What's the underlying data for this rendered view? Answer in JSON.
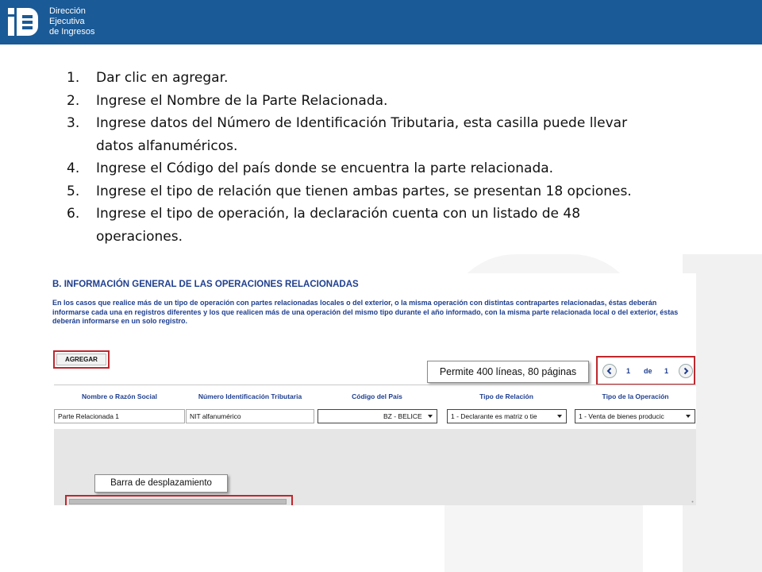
{
  "header": {
    "brand_color": "#1a5a96",
    "logo_icon": "die-logo-icon",
    "logo_line1": "Dirección",
    "logo_line2": "Ejecutiva",
    "logo_line3": "de Ingresos"
  },
  "steps": [
    {
      "num": "1.",
      "text": "Dar clic en agregar."
    },
    {
      "num": "2.",
      "text": "Ingrese el Nombre de la Parte Relacionada."
    },
    {
      "num": "3.",
      "text": "Ingrese datos del Número de Identificación Tributaria, esta casilla puede llevar datos alfanuméricos."
    },
    {
      "num": "4.",
      "text": "Ingrese el Código del país donde se encuentra la parte relacionada."
    },
    {
      "num": "5.",
      "text": "Ingrese el tipo de relación que tienen ambas partes, se presentan 18 opciones."
    },
    {
      "num": "6.",
      "text": "Ingrese el tipo de operación, la declaración cuenta con un listado de 48 operaciones."
    }
  ],
  "form": {
    "section_title": "B. INFORMACIÓN GENERAL DE LAS OPERACIONES RELACIONADAS",
    "section_desc": "En los casos que realice más de un tipo de operación con partes relacionadas locales o del exterior, o la misma operación con distintas contrapartes relacionadas, éstas deberán informarse cada una en registros diferentes y los que realicen más de una operación del mismo tipo durante el año informado, con la misma parte relacionada local o del exterior, éstas deberán informarse en un solo registro.",
    "add_button": "AGREGAR",
    "callout_lines": "Permite 400 líneas, 80 páginas",
    "pager": {
      "current": "1",
      "of_label": "de",
      "total": "1"
    },
    "columns": [
      "Nombre o Razón Social",
      "Número Identificación Tributaria",
      "Código del País",
      "Tipo de Relación",
      "Tipo de la Operación"
    ],
    "row": {
      "name": "Parte  Relacionada 1",
      "nit": "NIT alfanumérico",
      "country": "BZ - BELICE",
      "relation": "1 - Declarante es matriz o tie",
      "operation": "1 - Venta de bienes producic"
    },
    "callout_scroll": "Barra de desplazamiento",
    "accent_red": "#c0272d",
    "label_blue": "#1f3f8f"
  }
}
